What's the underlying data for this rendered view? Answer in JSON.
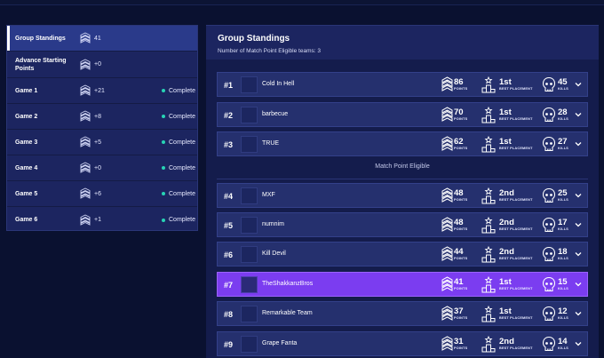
{
  "left_panel": {
    "items": [
      {
        "name": "Group Standings",
        "points": "41",
        "status": ""
      },
      {
        "name": "Advance Starting Points",
        "points": "+0",
        "status": ""
      },
      {
        "name": "Game 1",
        "points": "+21",
        "status": "Complete"
      },
      {
        "name": "Game 2",
        "points": "+8",
        "status": "Complete"
      },
      {
        "name": "Game 3",
        "points": "+5",
        "status": "Complete"
      },
      {
        "name": "Game 4",
        "points": "+0",
        "status": "Complete"
      },
      {
        "name": "Game 5",
        "points": "+6",
        "status": "Complete"
      },
      {
        "name": "Game 6",
        "points": "+1",
        "status": "Complete"
      }
    ]
  },
  "right_panel": {
    "title": "Group Standings",
    "subtitle": "Number of Match Point Eligible teams: 3",
    "divider_label": "Match Point Eligible",
    "stat_labels": {
      "points": "POINTS",
      "placement": "BEST PLACEMENT",
      "kills": "KILLS"
    },
    "teams": [
      {
        "rank": "#1",
        "name": "Cold In Hell",
        "points": "86",
        "placement": "1st",
        "kills": "45"
      },
      {
        "rank": "#2",
        "name": "barbecue",
        "points": "70",
        "placement": "1st",
        "kills": "28"
      },
      {
        "rank": "#3",
        "name": "TRUE",
        "points": "62",
        "placement": "1st",
        "kills": "27"
      },
      {
        "rank": "#4",
        "name": "MXF",
        "points": "48",
        "placement": "2nd",
        "kills": "25"
      },
      {
        "rank": "#5",
        "name": "numnim",
        "points": "48",
        "placement": "2nd",
        "kills": "17"
      },
      {
        "rank": "#6",
        "name": "Kill Devil",
        "points": "44",
        "placement": "2nd",
        "kills": "18"
      },
      {
        "rank": "#7",
        "name": "TheShakkanzBros",
        "points": "41",
        "placement": "1st",
        "kills": "15"
      },
      {
        "rank": "#8",
        "name": "Remarkable Team",
        "points": "37",
        "placement": "1st",
        "kills": "12"
      },
      {
        "rank": "#9",
        "name": "Grape Fanta",
        "points": "31",
        "placement": "2nd",
        "kills": "14"
      }
    ]
  },
  "colors": {
    "background": "#0a1130",
    "panel": "#1c2560",
    "row": "#25306e",
    "highlight_row": "#7b3df0",
    "status_dot": "#27d3b4"
  },
  "icons": {
    "points": "chevron-badge-icon",
    "placement": "podium-icon",
    "kills": "skull-icon",
    "expand": "chevron-down-icon"
  }
}
